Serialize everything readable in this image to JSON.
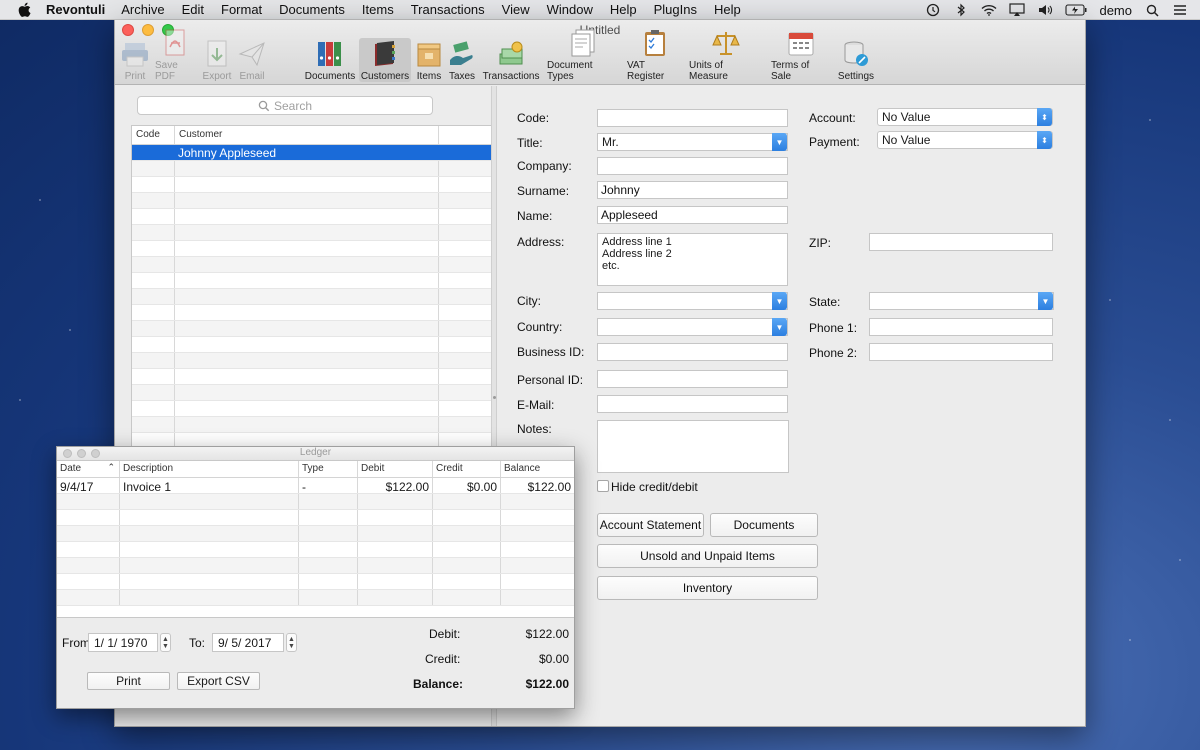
{
  "menubar": {
    "app_name": "Revontuli",
    "items": [
      "Archive",
      "Edit",
      "Format",
      "Documents",
      "Items",
      "Transactions",
      "View",
      "Window",
      "Help",
      "PlugIns",
      "Help"
    ],
    "user": "demo",
    "icons": [
      "time-machine-icon",
      "bluetooth-icon",
      "wifi-icon",
      "airplay-icon",
      "volume-icon",
      "battery-icon",
      "search-icon",
      "menu-icon"
    ]
  },
  "window": {
    "title": "Untitled",
    "toolbar": {
      "print": "Print",
      "save_pdf": "Save PDF",
      "export": "Export",
      "email": "Email",
      "documents": "Documents",
      "customers": "Customers",
      "items": "Items",
      "taxes": "Taxes",
      "transactions": "Transactions",
      "document_types": "Document Types",
      "vat_register": "VAT Register",
      "units_of_measure": "Units of Measure",
      "terms_of_sale": "Terms of Sale",
      "settings": "Settings"
    }
  },
  "customers": {
    "search_placeholder": "Search",
    "columns": {
      "code": "Code",
      "customer": "Customer"
    },
    "rows": [
      {
        "code": "",
        "customer": "Johnny Appleseed"
      }
    ]
  },
  "form": {
    "labels": {
      "code": "Code:",
      "title": "Title:",
      "company": "Company:",
      "surname": "Surname:",
      "name": "Name:",
      "address": "Address:",
      "city": "City:",
      "country": "Country:",
      "business_id": "Business ID:",
      "personal_id": "Personal ID:",
      "email": "E-Mail:",
      "notes": "Notes:",
      "account": "Account:",
      "payment": "Payment:",
      "zip": "ZIP:",
      "state": "State:",
      "phone1": "Phone 1:",
      "phone2": "Phone 2:"
    },
    "values": {
      "code": "",
      "title": "Mr.",
      "company": "",
      "surname": "Johnny",
      "name": "Appleseed",
      "address": "Address line 1\nAddress line 2\netc.",
      "city": "",
      "country": "",
      "business_id": "",
      "personal_id": "",
      "email": "",
      "notes": "",
      "account": "No Value",
      "payment": "No Value",
      "zip": "",
      "state": "",
      "phone1": "",
      "phone2": ""
    },
    "hide_credit_debit": "Hide credit/debit",
    "buttons": {
      "account_statement": "Account Statement",
      "documents": "Documents",
      "unsold_unpaid": "Unsold and Unpaid Items",
      "inventory": "Inventory"
    }
  },
  "ledger": {
    "title": "Ledger",
    "columns": {
      "date": "Date",
      "description": "Description",
      "type": "Type",
      "debit": "Debit",
      "credit": "Credit",
      "balance": "Balance"
    },
    "rows": [
      {
        "date": "9/4/17",
        "description": "Invoice 1",
        "type": "-",
        "debit": "$122.00",
        "credit": "$0.00",
        "balance": "$122.00"
      }
    ],
    "from_label": "From:",
    "from_value": "1/  1/ 1970",
    "to_label": "To:",
    "to_value": "9/  5/ 2017",
    "debit_label": "Debit:",
    "debit_total": "$122.00",
    "credit_label": "Credit:",
    "credit_total": "$0.00",
    "balance_label": "Balance:",
    "balance_total": "$122.00",
    "print_button": "Print",
    "export_csv_button": "Export CSV"
  }
}
